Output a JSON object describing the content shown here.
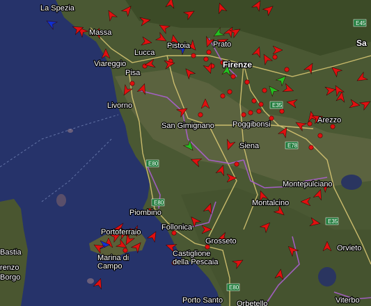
{
  "map": {
    "type": "satellite",
    "region": "Tuscany",
    "colors": {
      "sea": "#26336a",
      "land": "#4b5a34",
      "marker_red": "#e01010",
      "marker_green": "#22c022",
      "marker_blue": "#1030d0",
      "dot_red": "#e01010"
    },
    "places": {
      "la_spezia": "La Spezia",
      "massa": "Massa",
      "viareggio": "Viareggio",
      "lucca": "Lucca",
      "pistoia": "Pistoia",
      "prato": "Prato",
      "firenze": "Firenze",
      "pisa": "Pisa",
      "livorno": "Livorno",
      "san_gimignano": "San Gimignano",
      "poggibonsi": "Poggibonsi",
      "siena": "Siena",
      "arezzo": "Arezzo",
      "montepulciano": "Montepulciano",
      "montalcino": "Montalcino",
      "piombino": "Piombino",
      "follonica": "Follonica",
      "portoferraio": "Portoferraio",
      "marina_di_campo": "Marina di\nCampo",
      "castiglione": "Castiglione\ndella Pescaia",
      "grosseto": "Grosseto",
      "orvieto": "Orvieto",
      "bastia": "Bastia",
      "porto_santo": "Porto Santo",
      "orbetello": "Orbetello",
      "viterbo": "Viterbo",
      "sa": "Sa",
      "renzo": "renzo",
      "borgo": "Borgo"
    },
    "roads": {
      "e45": "E45",
      "e35a": "E35",
      "e35b": "E35",
      "e78": "E78",
      "e80a": "E80",
      "e80b": "E80",
      "e80c": "E80"
    }
  }
}
